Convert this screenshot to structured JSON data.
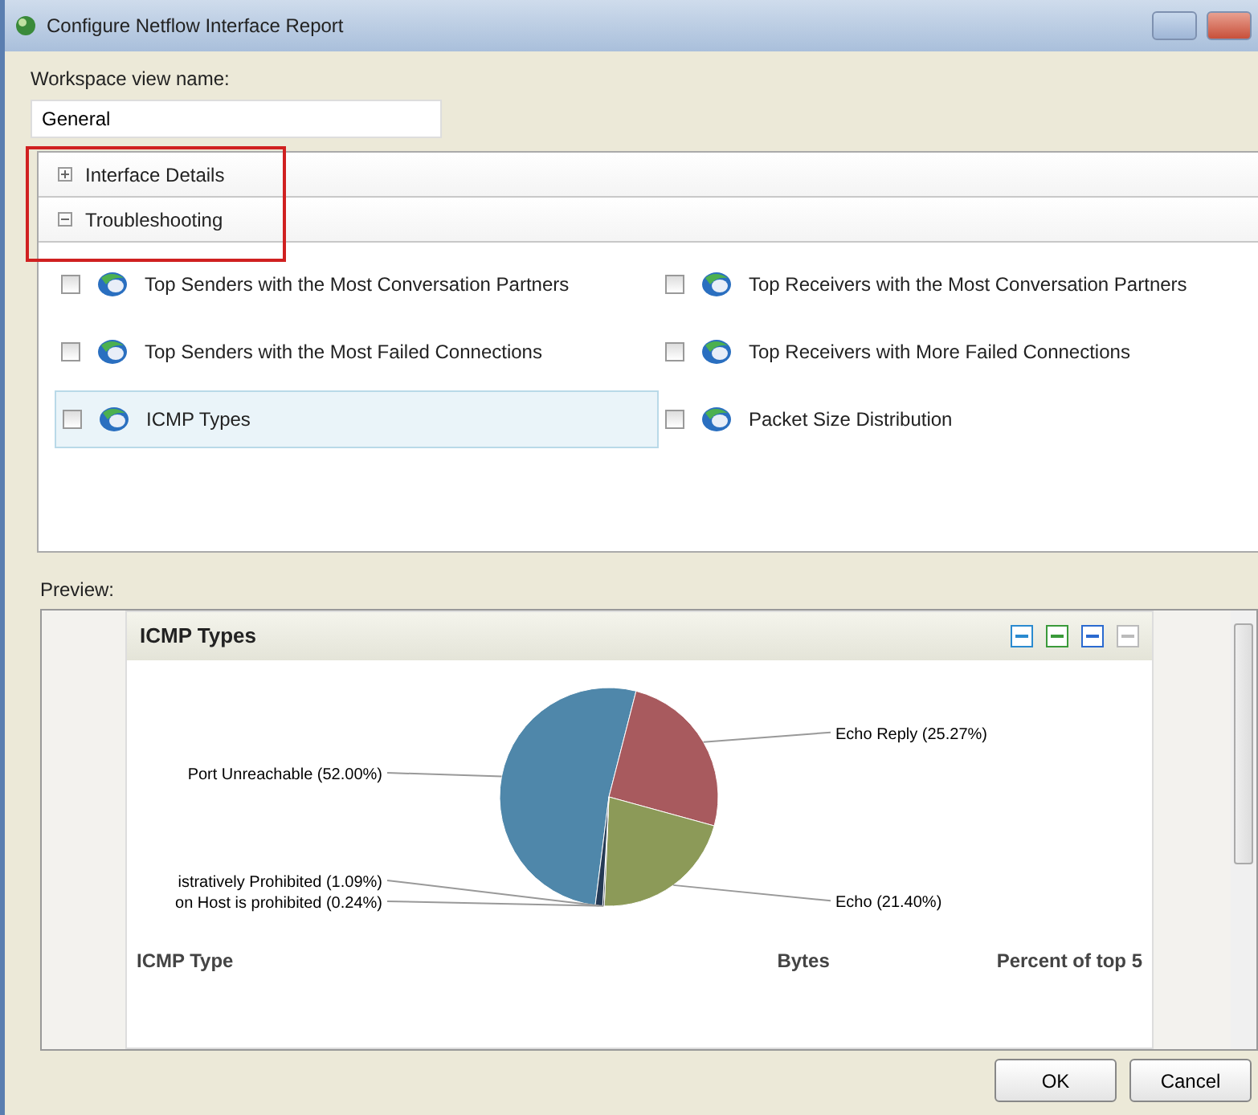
{
  "window": {
    "title": "Configure Netflow Interface Report"
  },
  "workspace": {
    "label": "Workspace view name:",
    "value": "General"
  },
  "sections": [
    {
      "title": "Interface Details",
      "expanded": false
    },
    {
      "title": "Troubleshooting",
      "expanded": true
    }
  ],
  "reports": [
    {
      "label": "Top Senders with the Most Conversation Partners",
      "checked": false,
      "selected": false
    },
    {
      "label": "Top Receivers with the Most Conversation Partners",
      "checked": false,
      "selected": false
    },
    {
      "label": "Top Senders with the Most Failed Connections",
      "checked": false,
      "selected": false
    },
    {
      "label": "Top Receivers with More Failed Connections",
      "checked": false,
      "selected": false
    },
    {
      "label": "ICMP Types",
      "checked": false,
      "selected": true
    },
    {
      "label": "Packet Size Distribution",
      "checked": false,
      "selected": false
    }
  ],
  "preview": {
    "label": "Preview:",
    "title": "ICMP Types",
    "chart_data": {
      "type": "pie",
      "categories": [
        "Port Unreachable (52.00%)",
        "Echo Reply (25.27%)",
        "Echo (21.40%)",
        "on Host is prohibited (0.24%)",
        "istratively Prohibited (1.09%)"
      ],
      "values": [
        52.0,
        25.27,
        21.4,
        0.24,
        1.09
      ],
      "colors": [
        "#4f87aa",
        "#a85a5e",
        "#8c9a58",
        "#3a4150",
        "#253a55"
      ]
    },
    "table": {
      "columns": [
        "ICMP Type",
        "Bytes",
        "Percent of top 5"
      ]
    }
  },
  "buttons": [
    "OK",
    "Cancel"
  ]
}
